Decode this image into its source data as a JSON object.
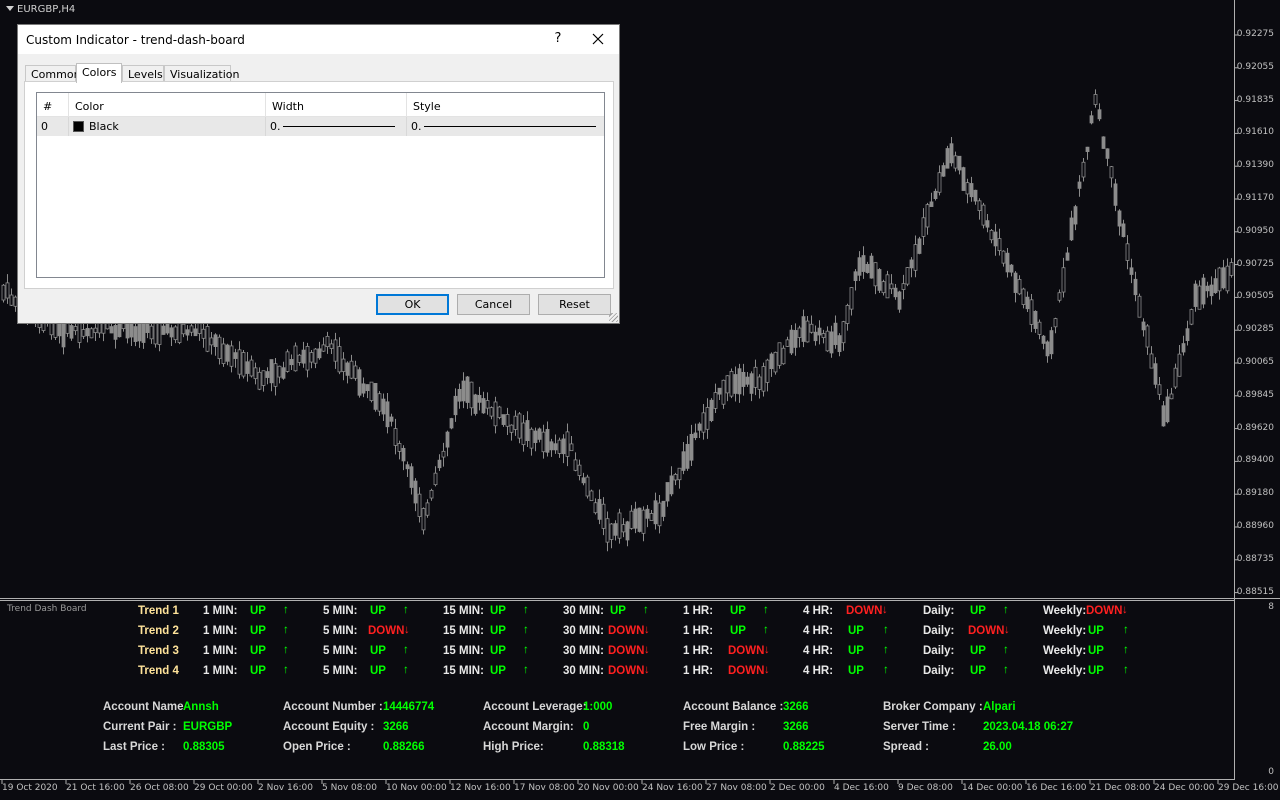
{
  "chart": {
    "symbol": "EURGBP,H4",
    "price_axis": [
      "0.92275",
      "0.92055",
      "0.91835",
      "0.91610",
      "0.91390",
      "0.91170",
      "0.90950",
      "0.90725",
      "0.90505",
      "0.90285",
      "0.90065",
      "0.89845",
      "0.89620",
      "0.89400",
      "0.89180",
      "0.88960",
      "0.88735",
      "0.88515"
    ],
    "sub_axis": [
      "8",
      "0"
    ],
    "time_axis": [
      "19 Oct 2020",
      "21 Oct 16:00",
      "26 Oct 08:00",
      "29 Oct 00:00",
      "2 Nov 16:00",
      "5 Nov 08:00",
      "10 Nov 00:00",
      "12 Nov 16:00",
      "17 Nov 08:00",
      "20 Nov 00:00",
      "24 Nov 16:00",
      "27 Nov 08:00",
      "2 Dec 00:00",
      "4 Dec 16:00",
      "9 Dec 08:00",
      "14 Dec 00:00",
      "16 Dec 16:00",
      "21 Dec 08:00",
      "24 Dec 00:00",
      "29 Dec 16:00"
    ],
    "candle_color": "#8c8c8c"
  },
  "subwindow": {
    "title": "Trend Dash Board"
  },
  "dashboard": {
    "rows": [
      {
        "name": "Trend 1",
        "cells": [
          [
            "1 MIN:",
            "UP",
            "up"
          ],
          [
            "5 MIN:",
            "UP",
            "up"
          ],
          [
            "15 MIN:",
            "UP",
            "up"
          ],
          [
            "30 MIN:",
            "UP",
            "up"
          ],
          [
            "1 HR:",
            "UP",
            "up"
          ],
          [
            "4 HR:",
            "DOWN",
            "down"
          ],
          [
            "Daily:",
            "UP",
            "up"
          ],
          [
            "Weekly:",
            "DOWN",
            "down"
          ]
        ]
      },
      {
        "name": "Trend 2",
        "cells": [
          [
            "1 MIN:",
            "UP",
            "up"
          ],
          [
            "5 MIN:",
            "DOWN",
            "down"
          ],
          [
            "15 MIN:",
            "UP",
            "up"
          ],
          [
            "30 MIN:",
            "DOWN",
            "down"
          ],
          [
            "1 HR:",
            "UP",
            "up"
          ],
          [
            "4 HR:",
            "UP",
            "up"
          ],
          [
            "Daily:",
            "DOWN",
            "down"
          ],
          [
            "Weekly:",
            "UP",
            "up"
          ]
        ]
      },
      {
        "name": "Trend 3",
        "cells": [
          [
            "1 MIN:",
            "UP",
            "up"
          ],
          [
            "5 MIN:",
            "UP",
            "up"
          ],
          [
            "15 MIN:",
            "UP",
            "up"
          ],
          [
            "30 MIN:",
            "DOWN",
            "down"
          ],
          [
            "1 HR:",
            "DOWN",
            "down"
          ],
          [
            "4 HR:",
            "UP",
            "up"
          ],
          [
            "Daily:",
            "UP",
            "up"
          ],
          [
            "Weekly:",
            "UP",
            "up"
          ]
        ]
      },
      {
        "name": "Trend 4",
        "cells": [
          [
            "1 MIN:",
            "UP",
            "up"
          ],
          [
            "5 MIN:",
            "UP",
            "up"
          ],
          [
            "15 MIN:",
            "UP",
            "up"
          ],
          [
            "30 MIN:",
            "DOWN",
            "down"
          ],
          [
            "1 HR:",
            "DOWN",
            "down"
          ],
          [
            "4 HR:",
            "UP",
            "up"
          ],
          [
            "Daily:",
            "UP",
            "up"
          ],
          [
            "Weekly:",
            "UP",
            "up"
          ]
        ]
      }
    ],
    "arrow_up": "↑",
    "arrow_down": "↓",
    "up_color": "#00ff00",
    "down_color": "#ff2020"
  },
  "account": {
    "columns": [
      [
        [
          "Account Name",
          "Annsh"
        ],
        [
          "Current Pair :",
          "EURGBP"
        ],
        [
          "Last Price :",
          "0.88305"
        ]
      ],
      [
        [
          "Account Number :",
          "14446774"
        ],
        [
          "Account Equity :",
          "3266"
        ],
        [
          "Open Price :",
          "0.88266"
        ]
      ],
      [
        [
          "Account Leverage:",
          "1:000"
        ],
        [
          "Account Margin:",
          "0"
        ],
        [
          "High Price:",
          "0.88318"
        ]
      ],
      [
        [
          "Account Balance :",
          "3266"
        ],
        [
          "Free Margin :",
          "3266"
        ],
        [
          "Low Price :",
          "0.88225"
        ]
      ],
      [
        [
          "Broker Company :",
          "Alpari"
        ],
        [
          "Server Time :",
          "2023.04.18 06:27"
        ],
        [
          "Spread :",
          "26.00"
        ]
      ]
    ]
  },
  "dialog": {
    "title": "Custom Indicator - trend-dash-board",
    "help": "?",
    "tabs": [
      "Common",
      "Colors",
      "Levels",
      "Visualization"
    ],
    "active_tab": "Colors",
    "grid_headers": [
      "#",
      "Color",
      "Width",
      "Style"
    ],
    "row": {
      "index": "0",
      "color": "Black",
      "width": "0.",
      "style": "0."
    },
    "buttons": {
      "ok": "OK",
      "cancel": "Cancel",
      "reset": "Reset"
    }
  }
}
